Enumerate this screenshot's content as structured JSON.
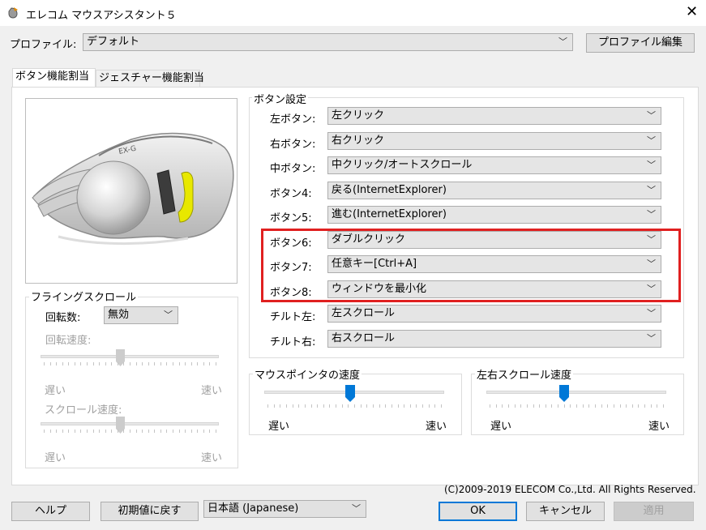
{
  "window": {
    "title": "エレコム マウスアシスタント５",
    "close_glyph": "✕"
  },
  "profile": {
    "label": "プロファイル:",
    "value": "デフォルト",
    "edit_button": "プロファイル編集"
  },
  "tabs": [
    {
      "label": "ボタン機能割当",
      "active": true
    },
    {
      "label": "ジェスチャー機能割当",
      "active": false
    }
  ],
  "button_settings": {
    "group_title": "ボタン設定",
    "rows": [
      {
        "label": "左ボタン:",
        "value": "左クリック"
      },
      {
        "label": "右ボタン:",
        "value": "右クリック"
      },
      {
        "label": "中ボタン:",
        "value": "中クリック/オートスクロール"
      },
      {
        "label": "ボタン4:",
        "value": "戻る(InternetExplorer)"
      },
      {
        "label": "ボタン5:",
        "value": "進む(InternetExplorer)"
      },
      {
        "label": "ボタン6:",
        "value": "ダブルクリック"
      },
      {
        "label": "ボタン7:",
        "value": "任意キー[Ctrl+A]"
      },
      {
        "label": "ボタン8:",
        "value": "ウィンドウを最小化"
      },
      {
        "label": "チルト左:",
        "value": "左スクロール"
      },
      {
        "label": "チルト右:",
        "value": "右スクロール"
      }
    ]
  },
  "flying_scroll": {
    "group_title": "フライングスクロール",
    "rotation_label": "回転数:",
    "rotation_value": "無効",
    "rotation_speed_label": "回転速度:",
    "rotation_speed_level": 0.5,
    "scroll_speed_label": "スクロール速度:",
    "scroll_speed_level": 0.5,
    "slow": "遅い",
    "fast": "速い"
  },
  "pointer_speed": {
    "group_title": "マウスポインタの速度",
    "level": 0.5,
    "slow": "遅い",
    "fast": "速い"
  },
  "horizontal_scroll_speed": {
    "group_title": "左右スクロール速度",
    "level": 0.43,
    "slow": "遅い",
    "fast": "速い"
  },
  "copyright": "(C)2009-2019 ELECOM Co.,Ltd. All Rights Reserved.",
  "footer": {
    "help": "ヘルプ",
    "reset": "初期値に戻す",
    "language": "日本語 (Japanese)",
    "ok": "OK",
    "cancel": "キャンセル",
    "apply": "適用"
  },
  "colors": {
    "accent": "#0078d7",
    "highlight_box": "#e02020",
    "button_highlight": "#e8e800"
  }
}
